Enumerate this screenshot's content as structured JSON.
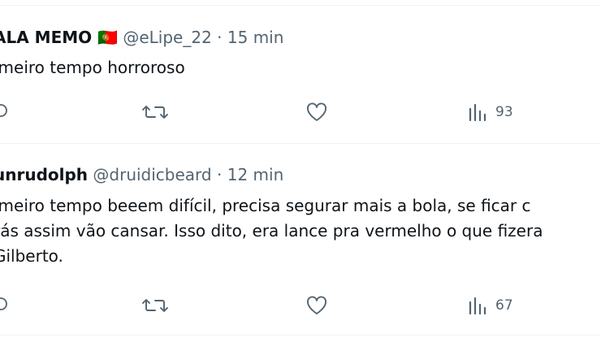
{
  "tweets": [
    {
      "name": "ALA MEMO 🇵🇹",
      "handle": "@eLipe_22",
      "sep": "·",
      "time": "15 min",
      "text": [
        "imeiro tempo horroroso"
      ],
      "views": "93"
    },
    {
      "name": "unrudolph",
      "handle": "@druidicbeard",
      "sep": "·",
      "time": "12 min",
      "text": [
        "imeiro tempo beeem difícil, precisa segurar mais a bola, se ficar c",
        "rás assim vão cansar. Isso dito, era lance pra vermelho o que fizera",
        "Gilberto."
      ],
      "views": "67"
    }
  ],
  "icons": {
    "reply": "reply-icon",
    "retweet": "retweet-icon",
    "like": "heart-icon",
    "views": "views-chart-icon"
  },
  "colors": {
    "text": "#0f1419",
    "muted": "#536471",
    "divider": "#eff3f4"
  }
}
